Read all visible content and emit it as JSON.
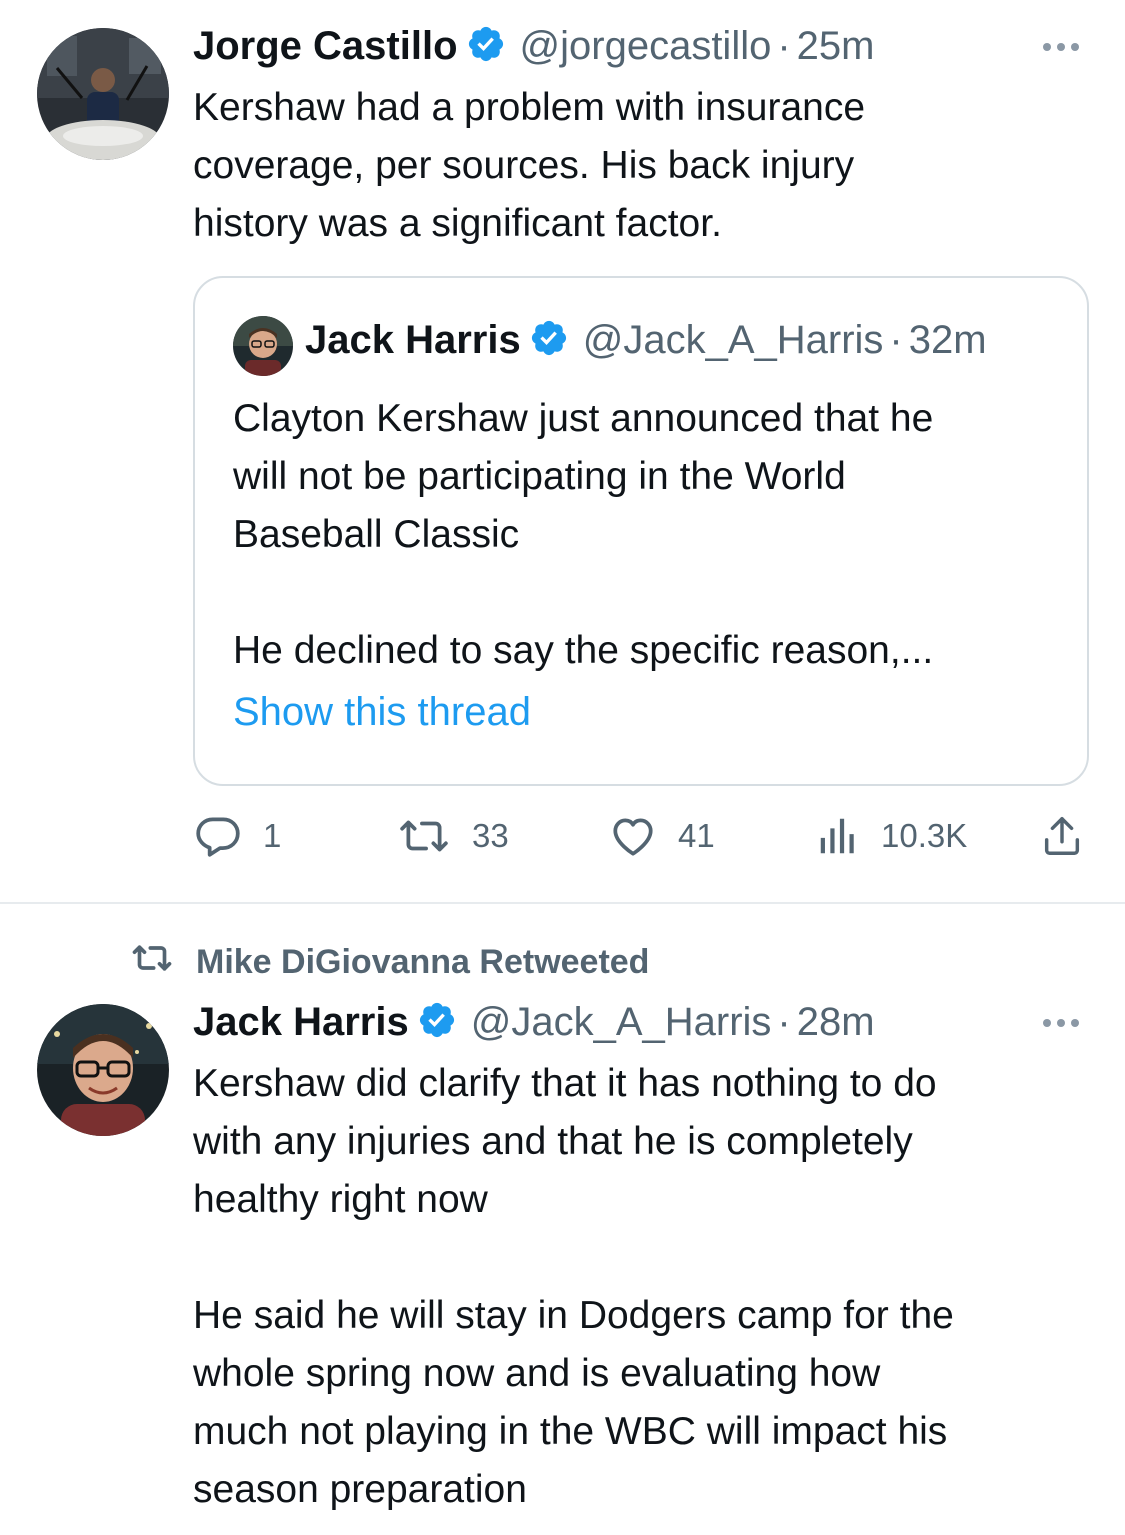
{
  "tweet1": {
    "author_name": "Jorge Castillo",
    "handle": "@jorgecastillo",
    "separator": "·",
    "time": "25m",
    "text": "Kershaw had a problem with insurance\ncoverage, per sources. His back injury\nhistory was a significant factor.",
    "quoted": {
      "author_name": "Jack Harris",
      "handle": "@Jack_A_Harris",
      "separator": "·",
      "time": "32m",
      "text": "Clayton Kershaw just announced that he\nwill not be participating in the World\nBaseball Classic\n\nHe declined to say the specific reason,...",
      "show_thread": "Show this thread"
    },
    "actions": {
      "replies": "1",
      "retweets": "33",
      "likes": "41",
      "views": "10.3K"
    }
  },
  "tweet2": {
    "retweeted_by": "Mike DiGiovanna Retweeted",
    "author_name": "Jack Harris",
    "handle": "@Jack_A_Harris",
    "separator": "·",
    "time": "28m",
    "text": "Kershaw did clarify that it has nothing to do\nwith any injuries and that he is completely\nhealthy right now\n\nHe said he will stay in Dodgers camp for the\nwhole spring now and is evaluating how\nmuch not playing in the WBC will impact his\nseason preparation"
  },
  "colors": {
    "link": "#1d9bf0",
    "verified": "#1d9bf0",
    "secondary_text": "#536471",
    "border": "#d6dde2"
  },
  "icons": [
    "verified-badge-icon",
    "more-icon",
    "reply-icon",
    "retweet-icon",
    "like-icon",
    "views-icon",
    "share-icon"
  ]
}
